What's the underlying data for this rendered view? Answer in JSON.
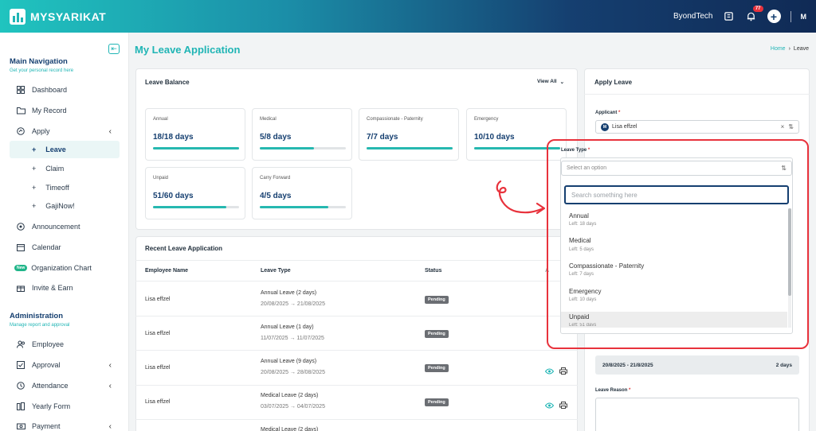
{
  "topbar": {
    "brand": "MYSYARIKAT",
    "company": "ByondTech",
    "notif_count": "77",
    "user_initials": "M"
  },
  "sidebar": {
    "main_title": "Main Navigation",
    "main_sub": "Get your personal record here",
    "items": [
      {
        "label": "Dashboard",
        "icon": "grid-icon"
      },
      {
        "label": "My Record",
        "icon": "folder-icon"
      },
      {
        "label": "Apply",
        "icon": "globe-icon"
      }
    ],
    "apply_sub": [
      "Leave",
      "Claim",
      "Timeoff",
      "GajiNow!"
    ],
    "items2": [
      {
        "label": "Announcement",
        "icon": "megaphone-icon"
      },
      {
        "label": "Calendar",
        "icon": "calendar-icon"
      },
      {
        "label": "Organization Chart",
        "icon": "new-badge"
      },
      {
        "label": "Invite & Earn",
        "icon": "gift-icon"
      }
    ],
    "new_tag": "New",
    "admin_title": "Administration",
    "admin_sub": "Manage report and approval",
    "admin_items": [
      {
        "label": "Employee",
        "icon": "users-icon"
      },
      {
        "label": "Approval",
        "icon": "check-square-icon"
      },
      {
        "label": "Attendance",
        "icon": "clock-icon"
      },
      {
        "label": "Yearly Form",
        "icon": "form-icon"
      },
      {
        "label": "Payment",
        "icon": "money-icon"
      }
    ]
  },
  "header": {
    "title": "My Leave Application",
    "breadcrumb_home": "Home",
    "breadcrumb_current": "Leave"
  },
  "leave_balance": {
    "title": "Leave Balance",
    "view_all": "View All",
    "items": [
      {
        "name": "Annual",
        "value": "18/18 days",
        "fraction": 1.0
      },
      {
        "name": "Medical",
        "value": "5/8 days",
        "fraction": 0.625
      },
      {
        "name": "Compassionate - Paternity",
        "value": "7/7 days",
        "fraction": 1.0
      },
      {
        "name": "Emergency",
        "value": "10/10 days",
        "fraction": 1.0
      },
      {
        "name": "Unpaid",
        "value": "51/60 days",
        "fraction": 0.85
      },
      {
        "name": "Carry Forward",
        "value": "4/5 days",
        "fraction": 0.8
      }
    ]
  },
  "recent": {
    "title": "Recent Leave Application",
    "headers": [
      "Employee Name",
      "Leave Type",
      "Status",
      "A"
    ],
    "rows": [
      {
        "name": "Lisa effzel",
        "type": "Annual Leave (2 days)",
        "dates": "20/08/2025 → 21/08/2025",
        "status": "Pending"
      },
      {
        "name": "Lisa effzel",
        "type": "Annual Leave (1 day)",
        "dates": "11/07/2025 → 11/07/2025",
        "status": "Pending"
      },
      {
        "name": "Lisa effzel",
        "type": "Annual Leave (9 days)",
        "dates": "20/08/2025 → 28/08/2025",
        "status": "Pending"
      },
      {
        "name": "Lisa effzel",
        "type": "Medical Leave (2 days)",
        "dates": "03/07/2025 → 04/07/2025",
        "status": "Pending"
      },
      {
        "name": "",
        "type": "Medical Leave (2 days)",
        "dates": "",
        "status": ""
      }
    ]
  },
  "apply": {
    "title": "Apply Leave",
    "applicant_label": "Applicant",
    "applicant_value": "Lisa effzel",
    "applicant_initial": "M",
    "leave_type_label": "Leave Type",
    "leave_type_placeholder": "Select an option",
    "search_placeholder": "Search something here",
    "options": [
      {
        "name": "Annual",
        "left": "Left: 18 days"
      },
      {
        "name": "Medical",
        "left": "Left: 5 days"
      },
      {
        "name": "Compassionate - Paternity",
        "left": "Left: 7 days"
      },
      {
        "name": "Emergency",
        "left": "Left: 10 days"
      },
      {
        "name": "Unpaid",
        "left": "Left: 51 days"
      }
    ],
    "date_range": "20/8/2025 - 21/8/2025",
    "date_days": "2 days",
    "reason_label": "Leave Reason",
    "required": "*"
  },
  "colors": {
    "accent": "#20b5b5",
    "navy": "#153f70",
    "annotation": "#e8323c"
  }
}
